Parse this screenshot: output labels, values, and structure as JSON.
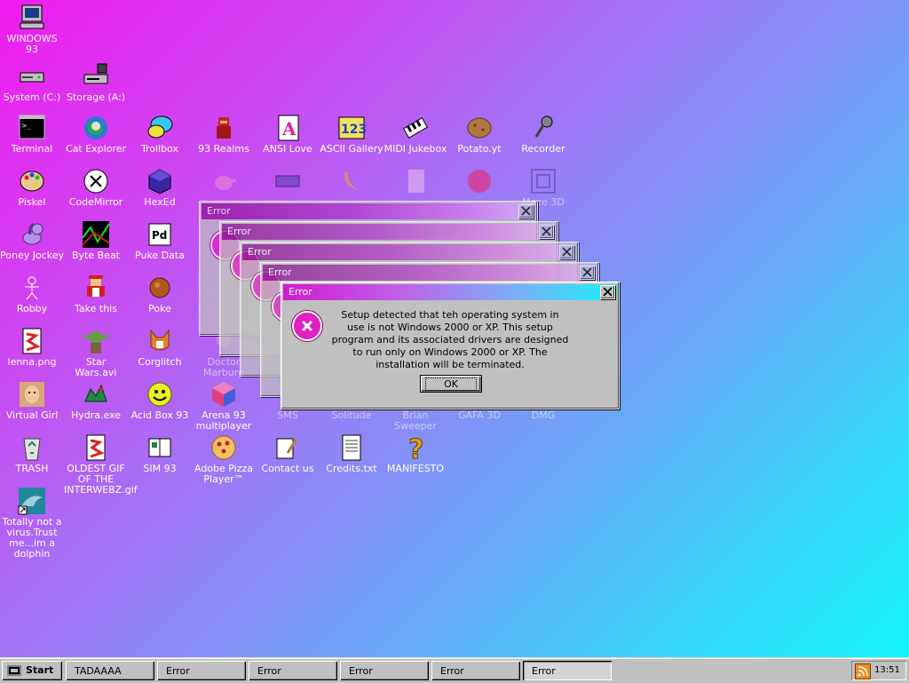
{
  "desktop": {
    "icons": [
      {
        "label": "WINDOWS 93",
        "icon": "computer-icon"
      },
      {
        "label": "System (C:)",
        "icon": "hard-drive-icon"
      },
      {
        "label": "Storage (A:)",
        "icon": "floppy-drive-icon"
      },
      {
        "label": "Terminal",
        "icon": "terminal-icon"
      },
      {
        "label": "Cat Explorer",
        "icon": "cat-globe-icon"
      },
      {
        "label": "Trollbox",
        "icon": "chat-bubble-icon"
      },
      {
        "label": "93 Realms",
        "icon": "knight-icon"
      },
      {
        "label": "ANSI Love",
        "icon": "letter-a-icon"
      },
      {
        "label": "ASCII Gallery",
        "icon": "numbers-123-icon"
      },
      {
        "label": "MIDI Jukebox",
        "icon": "piano-keys-icon"
      },
      {
        "label": "Potato.yt",
        "icon": "potato-icon"
      },
      {
        "label": "Recorder",
        "icon": "microphone-icon"
      },
      {
        "label": "Piskel",
        "icon": "palette-icon"
      },
      {
        "label": "CodeMirror",
        "icon": "codemirror-icon"
      },
      {
        "label": "HexEd",
        "icon": "cube-icon"
      },
      {
        "label": "Poney Jockey",
        "icon": "pony-icon"
      },
      {
        "label": "Byte Beat",
        "icon": "bytebeat-icon"
      },
      {
        "label": "Puke Data",
        "icon": "puke-data-icon"
      },
      {
        "label": "Robby",
        "icon": "robot-figure-icon"
      },
      {
        "label": "Take this",
        "icon": "pixel-man-icon"
      },
      {
        "label": "Poke",
        "icon": "pokeball-icon"
      },
      {
        "label": "lenna.png",
        "icon": "image-file-icon"
      },
      {
        "label": "Star Wars.avi",
        "icon": "yoda-icon"
      },
      {
        "label": "Corglitch",
        "icon": "corgi-icon"
      },
      {
        "label": "Doctor Marburg",
        "icon": "doctor-icon"
      },
      {
        "label": "Virtual Girl",
        "icon": "girl-face-icon"
      },
      {
        "label": "Hydra.exe",
        "icon": "dragon-icon"
      },
      {
        "label": "Acid Box 93",
        "icon": "smiley-icon"
      },
      {
        "label": "Arena 93 multiplayer",
        "icon": "arena-cube-icon"
      },
      {
        "label": "SMS",
        "icon": "sms-icon"
      },
      {
        "label": "Solitude",
        "icon": "cards-icon"
      },
      {
        "label": "Brian Sweeper",
        "icon": "mine-icon"
      },
      {
        "label": "GAFA 3D",
        "icon": "gafa-icon"
      },
      {
        "label": "DMG",
        "icon": "dmg-icon"
      },
      {
        "label": "TRASH",
        "icon": "recycle-bin-icon"
      },
      {
        "label": "OLDEST GIF OF THE INTERWEBZ.gif",
        "icon": "gif-file-icon"
      },
      {
        "label": "SIM 93",
        "icon": "sim-book-icon"
      },
      {
        "label": "Adobe Pizza Player™",
        "icon": "pizza-icon"
      },
      {
        "label": "Contact us",
        "icon": "contact-icon"
      },
      {
        "label": "Credits.txt",
        "icon": "text-file-icon"
      },
      {
        "label": "MANIFESTO",
        "icon": "question-mark-icon"
      },
      {
        "label": "Totally not a virus.Trust me...im a dolphin",
        "icon": "dolphin-shortcut-icon"
      },
      {
        "label": "",
        "icon": "teapot-icon"
      },
      {
        "label": "",
        "icon": "keyboard-icon"
      },
      {
        "label": "",
        "icon": "banana-icon"
      },
      {
        "label": "",
        "icon": "speaker-file-icon"
      },
      {
        "label": "",
        "icon": "amiga-ball-icon"
      },
      {
        "label": "Maze 3D",
        "icon": "maze-icon"
      }
    ]
  },
  "dialogs": {
    "title": "Error",
    "message": "Setup detected that teh operating system in use is not Windows 2000 or XP. This setup program and its associated drivers are designed to run only on Windows 2000 or XP. The installation will be terminated.",
    "ok_label": "OK"
  },
  "taskbar": {
    "start_label": "Start",
    "tasks": [
      "TADAAAA",
      "Error",
      "Error",
      "Error",
      "Error",
      "Error"
    ],
    "clock": "13:51"
  },
  "colors": {
    "gradient_start": "#f01cf0",
    "gradient_end": "#10f8fc",
    "title_active_start": "#d01cd0",
    "title_active_end": "#18f0f8"
  }
}
